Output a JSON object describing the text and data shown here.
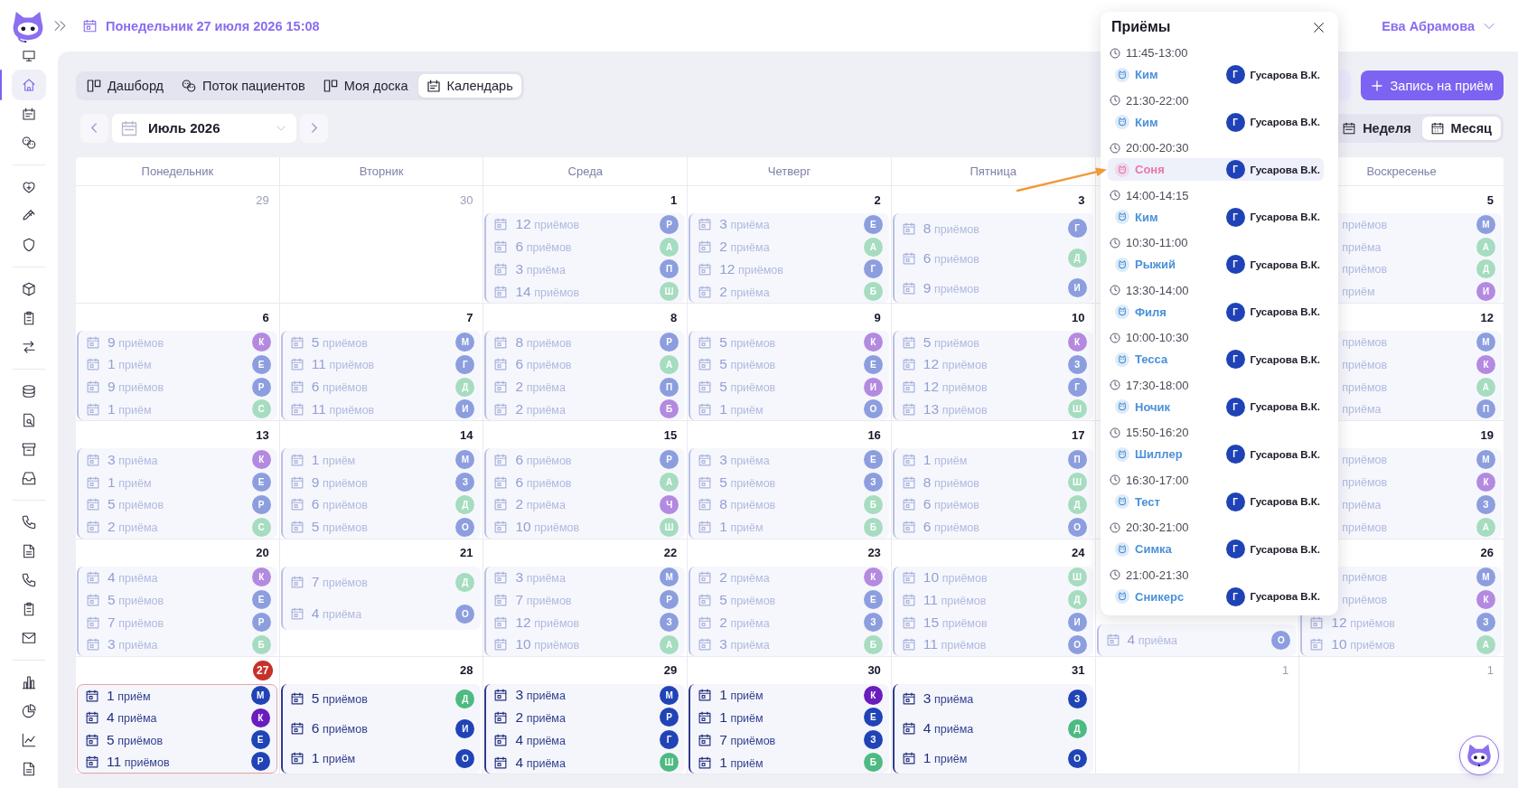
{
  "header": {
    "date": "Понедельник 27 июля 2026 15:08",
    "user": "Ева Абрамова"
  },
  "sidebar": {
    "groups": [
      [
        {
          "selected": false
        },
        {
          "selected": true
        },
        {
          "selected": false
        },
        {
          "selected": false
        }
      ],
      [
        {
          "selected": false
        },
        {
          "selected": false
        },
        {
          "selected": false
        }
      ],
      [
        {
          "selected": false
        },
        {
          "selected": false
        },
        {
          "selected": false
        }
      ],
      [
        {
          "selected": false
        },
        {
          "selected": false
        },
        {
          "selected": false
        },
        {
          "selected": false
        }
      ],
      [
        {
          "selected": false
        },
        {
          "selected": false
        },
        {
          "selected": false
        },
        {
          "selected": false
        },
        {
          "selected": false
        }
      ],
      [
        {
          "selected": false
        },
        {
          "selected": false
        },
        {
          "selected": false
        },
        {
          "selected": false
        }
      ]
    ]
  },
  "tabs": [
    {
      "label": "Дашборд",
      "selected": false
    },
    {
      "label": "Поток пациентов",
      "selected": false
    },
    {
      "label": "Моя доска",
      "selected": false
    },
    {
      "label": "Календарь",
      "selected": true
    }
  ],
  "new_appointment_button": "Запись на приём",
  "month_picker": {
    "value": "Июль 2026"
  },
  "view_switch": [
    {
      "label": "Неделя",
      "selected": false
    },
    {
      "label": "Месяц",
      "selected": true
    }
  ],
  "calendar": {
    "weekdays": {
      "mon": "Понедельник",
      "tue": "Вторник",
      "wed": "Среда",
      "thu": "Четверг",
      "fri": "Пятница",
      "sun": "Воскресенье"
    },
    "weeks": [
      {
        "mon": {
          "date": "29",
          "outside": true,
          "today": false
        },
        "tue": {
          "date": "30",
          "outside": true,
          "today": false
        },
        "wed": {
          "date": "1",
          "outside": false,
          "today": false,
          "past": true,
          "entries": [
            {
              "count": "12",
              "unit": "приёмов",
              "avatar": "Р",
              "color": "#8c9ede"
            },
            {
              "count": "6",
              "unit": "приёмов",
              "avatar": "А",
              "color": "#a6dcbf"
            },
            {
              "count": "3",
              "unit": "приёма",
              "avatar": "П",
              "color": "#8c9ede"
            },
            {
              "count": "14",
              "unit": "приёмов",
              "avatar": "Ш",
              "color": "#a6dcbf"
            }
          ]
        },
        "thu": {
          "date": "2",
          "outside": false,
          "today": false,
          "past": true,
          "entries": [
            {
              "count": "3",
              "unit": "приёма",
              "avatar": "Е",
              "color": "#8c9ede"
            },
            {
              "count": "2",
              "unit": "приёма",
              "avatar": "А",
              "color": "#a6dcbf"
            },
            {
              "count": "12",
              "unit": "приёмов",
              "avatar": "Г",
              "color": "#8c9ede"
            },
            {
              "count": "2",
              "unit": "приёма",
              "avatar": "Б",
              "color": "#a6dcbf"
            }
          ]
        },
        "fri": {
          "date": "3",
          "outside": false,
          "today": false,
          "past": true,
          "entries": [
            {
              "count": "8",
              "unit": "приёмов",
              "avatar": "Г",
              "color": "#8c9ede"
            },
            {
              "count": "6",
              "unit": "приёмов",
              "avatar": "Д",
              "color": "#a6dcbf"
            },
            {
              "count": "9",
              "unit": "приёмов",
              "avatar": "И",
              "color": "#8c9ede"
            }
          ]
        },
        "sun": {
          "date": "5",
          "outside": false,
          "today": false,
          "past": true,
          "entries": [
            {
              "unit": "приёмов",
              "avatar": "М",
              "color": "#8c9ede"
            },
            {
              "unit": "приёма",
              "avatar": "А",
              "color": "#a6dcbf"
            },
            {
              "unit": "приёмов",
              "avatar": "Д",
              "color": "#a6dcbf"
            },
            {
              "unit": "приём",
              "avatar": "И",
              "color": "#b38ae0"
            }
          ]
        }
      },
      {
        "mon": {
          "date": "6",
          "outside": false,
          "today": false,
          "past": true,
          "entries": [
            {
              "count": "9",
              "unit": "приёмов",
              "avatar": "К",
              "color": "#b38ae0"
            },
            {
              "count": "1",
              "unit": "приём",
              "avatar": "Е",
              "color": "#8c9ede"
            },
            {
              "count": "9",
              "unit": "приёмов",
              "avatar": "Р",
              "color": "#8c9ede"
            },
            {
              "count": "1",
              "unit": "приём",
              "avatar": "С",
              "color": "#a6dcbf"
            }
          ]
        },
        "tue": {
          "date": "7",
          "outside": false,
          "today": false,
          "past": true,
          "entries": [
            {
              "count": "5",
              "unit": "приёмов",
              "avatar": "М",
              "color": "#8c9ede"
            },
            {
              "count": "11",
              "unit": "приёмов",
              "avatar": "Г",
              "color": "#8c9ede"
            },
            {
              "count": "6",
              "unit": "приёмов",
              "avatar": "Д",
              "color": "#a6dcbf"
            },
            {
              "count": "11",
              "unit": "приёмов",
              "avatar": "И",
              "color": "#8c9ede"
            }
          ]
        },
        "wed": {
          "date": "8",
          "outside": false,
          "today": false,
          "past": true,
          "entries": [
            {
              "count": "8",
              "unit": "приёмов",
              "avatar": "Р",
              "color": "#8c9ede"
            },
            {
              "count": "6",
              "unit": "приёмов",
              "avatar": "А",
              "color": "#a6dcbf"
            },
            {
              "count": "2",
              "unit": "приёма",
              "avatar": "П",
              "color": "#8c9ede"
            },
            {
              "count": "2",
              "unit": "приёма",
              "avatar": "Б",
              "color": "#b38ae0"
            }
          ]
        },
        "thu": {
          "date": "9",
          "outside": false,
          "today": false,
          "past": true,
          "entries": [
            {
              "count": "5",
              "unit": "приёмов",
              "avatar": "К",
              "color": "#b38ae0"
            },
            {
              "count": "5",
              "unit": "приёмов",
              "avatar": "Е",
              "color": "#8c9ede"
            },
            {
              "count": "5",
              "unit": "приёмов",
              "avatar": "И",
              "color": "#b38ae0"
            },
            {
              "count": "1",
              "unit": "приём",
              "avatar": "О",
              "color": "#8c9ede"
            }
          ]
        },
        "fri": {
          "date": "10",
          "outside": false,
          "today": false,
          "past": true,
          "entries": [
            {
              "count": "5",
              "unit": "приёмов",
              "avatar": "К",
              "color": "#b38ae0"
            },
            {
              "count": "12",
              "unit": "приёмов",
              "avatar": "З",
              "color": "#8c9ede"
            },
            {
              "count": "12",
              "unit": "приёмов",
              "avatar": "Г",
              "color": "#8c9ede"
            },
            {
              "count": "13",
              "unit": "приёмов",
              "avatar": "Ш",
              "color": "#a6dcbf"
            }
          ]
        },
        "sun": {
          "date": "12",
          "outside": false,
          "today": false,
          "past": true,
          "entries": [
            {
              "unit": "приёмов",
              "avatar": "М",
              "color": "#8c9ede"
            },
            {
              "unit": "приёмов",
              "avatar": "К",
              "color": "#b38ae0"
            },
            {
              "unit": "приёмов",
              "avatar": "А",
              "color": "#a6dcbf"
            },
            {
              "unit": "приёма",
              "avatar": "П",
              "color": "#8c9ede"
            }
          ]
        }
      },
      {
        "mon": {
          "date": "13",
          "outside": false,
          "today": false,
          "past": true,
          "entries": [
            {
              "count": "3",
              "unit": "приёма",
              "avatar": "К",
              "color": "#b38ae0"
            },
            {
              "count": "1",
              "unit": "приём",
              "avatar": "Е",
              "color": "#8c9ede"
            },
            {
              "count": "5",
              "unit": "приёмов",
              "avatar": "Р",
              "color": "#8c9ede"
            },
            {
              "count": "2",
              "unit": "приёма",
              "avatar": "С",
              "color": "#a6dcbf"
            }
          ]
        },
        "tue": {
          "date": "14",
          "outside": false,
          "today": false,
          "past": true,
          "entries": [
            {
              "count": "1",
              "unit": "приём",
              "avatar": "М",
              "color": "#8c9ede"
            },
            {
              "count": "9",
              "unit": "приёмов",
              "avatar": "З",
              "color": "#8c9ede"
            },
            {
              "count": "6",
              "unit": "приёмов",
              "avatar": "Д",
              "color": "#a6dcbf"
            },
            {
              "count": "5",
              "unit": "приёмов",
              "avatar": "О",
              "color": "#8c9ede"
            }
          ]
        },
        "wed": {
          "date": "15",
          "outside": false,
          "today": false,
          "past": true,
          "entries": [
            {
              "count": "6",
              "unit": "приёмов",
              "avatar": "Р",
              "color": "#8c9ede"
            },
            {
              "count": "6",
              "unit": "приёмов",
              "avatar": "А",
              "color": "#a6dcbf"
            },
            {
              "count": "2",
              "unit": "приёма",
              "avatar": "Ч",
              "color": "#b38ae0"
            },
            {
              "count": "10",
              "unit": "приёмов",
              "avatar": "Ш",
              "color": "#a6dcbf"
            }
          ]
        },
        "thu": {
          "date": "16",
          "outside": false,
          "today": false,
          "past": true,
          "entries": [
            {
              "count": "3",
              "unit": "приёма",
              "avatar": "Е",
              "color": "#8c9ede"
            },
            {
              "count": "5",
              "unit": "приёмов",
              "avatar": "З",
              "color": "#8c9ede"
            },
            {
              "count": "8",
              "unit": "приёмов",
              "avatar": "Б",
              "color": "#a6dcbf"
            },
            {
              "count": "1",
              "unit": "приём",
              "avatar": "Б",
              "color": "#a6dcbf"
            }
          ]
        },
        "fri": {
          "date": "17",
          "outside": false,
          "today": false,
          "past": true,
          "entries": [
            {
              "count": "1",
              "unit": "приём",
              "avatar": "П",
              "color": "#8c9ede"
            },
            {
              "count": "8",
              "unit": "приёмов",
              "avatar": "Ш",
              "color": "#a6dcbf"
            },
            {
              "count": "6",
              "unit": "приёмов",
              "avatar": "Д",
              "color": "#a6dcbf"
            },
            {
              "count": "6",
              "unit": "приёмов",
              "avatar": "О",
              "color": "#8c9ede"
            }
          ]
        },
        "sun": {
          "date": "19",
          "outside": false,
          "today": false,
          "past": true,
          "entries": [
            {
              "unit": "приёмов",
              "avatar": "М",
              "color": "#8c9ede"
            },
            {
              "unit": "приёмов",
              "avatar": "К",
              "color": "#b38ae0"
            },
            {
              "unit": "приёма",
              "avatar": "З",
              "color": "#8c9ede"
            },
            {
              "unit": "приёмов",
              "avatar": "А",
              "color": "#a6dcbf"
            }
          ]
        }
      },
      {
        "mon": {
          "date": "20",
          "outside": false,
          "today": false,
          "past": true,
          "entries": [
            {
              "count": "4",
              "unit": "приёма",
              "avatar": "К",
              "color": "#b38ae0"
            },
            {
              "count": "5",
              "unit": "приёмов",
              "avatar": "Е",
              "color": "#8c9ede"
            },
            {
              "count": "7",
              "unit": "приёмов",
              "avatar": "Р",
              "color": "#8c9ede"
            },
            {
              "count": "3",
              "unit": "приёма",
              "avatar": "Б",
              "color": "#a6dcbf"
            }
          ]
        },
        "tue": {
          "date": "21",
          "outside": false,
          "today": false,
          "past": true,
          "entries": [
            {
              "count": "7",
              "unit": "приёмов",
              "avatar": "Д",
              "color": "#a6dcbf"
            },
            {
              "count": "4",
              "unit": "приёма",
              "avatar": "О",
              "color": "#8c9ede"
            }
          ]
        },
        "wed": {
          "date": "22",
          "outside": false,
          "today": false,
          "past": true,
          "entries": [
            {
              "count": "3",
              "unit": "приёма",
              "avatar": "М",
              "color": "#8c9ede"
            },
            {
              "count": "7",
              "unit": "приёмов",
              "avatar": "Р",
              "color": "#8c9ede"
            },
            {
              "count": "12",
              "unit": "приёмов",
              "avatar": "З",
              "color": "#8c9ede"
            },
            {
              "count": "10",
              "unit": "приёмов",
              "avatar": "А",
              "color": "#a6dcbf"
            }
          ]
        },
        "thu": {
          "date": "23",
          "outside": false,
          "today": false,
          "past": true,
          "entries": [
            {
              "count": "2",
              "unit": "приёма",
              "avatar": "К",
              "color": "#b38ae0"
            },
            {
              "count": "5",
              "unit": "приёмов",
              "avatar": "Е",
              "color": "#8c9ede"
            },
            {
              "count": "2",
              "unit": "приёма",
              "avatar": "З",
              "color": "#8c9ede"
            },
            {
              "count": "3",
              "unit": "приёма",
              "avatar": "Б",
              "color": "#a6dcbf"
            }
          ]
        },
        "fri": {
          "date": "24",
          "outside": false,
          "today": false,
          "past": true,
          "entries": [
            {
              "count": "10",
              "unit": "приёмов",
              "avatar": "Ш",
              "color": "#a6dcbf"
            },
            {
              "count": "11",
              "unit": "приёмов",
              "avatar": "Д",
              "color": "#a6dcbf"
            },
            {
              "count": "15",
              "unit": "приёмов",
              "avatar": "И",
              "color": "#8c9ede"
            },
            {
              "count": "11",
              "unit": "приёмов",
              "avatar": "О",
              "color": "#8c9ede"
            }
          ]
        },
        "sat": {
          "today": false,
          "past": true,
          "entries": [
            {
              "count": "4",
              "unit": "приёма",
              "avatar": "О",
              "color": "#8c9ede"
            }
          ]
        },
        "sun": {
          "date": "26",
          "outside": false,
          "today": false,
          "past": true,
          "entries": [
            {
              "unit": "приёмов",
              "avatar": "М",
              "color": "#8c9ede"
            },
            {
              "unit": "приёмов",
              "avatar": "К",
              "color": "#b38ae0"
            },
            {
              "count": "12",
              "unit": "приёмов",
              "avatar": "З",
              "color": "#8c9ede"
            },
            {
              "count": "10",
              "unit": "приёмов",
              "avatar": "А",
              "color": "#a6dcbf"
            }
          ]
        }
      },
      {
        "mon": {
          "date": "27",
          "outside": false,
          "today": true,
          "past": false,
          "entries": [
            {
              "count": "1",
              "unit": "приём",
              "avatar": "М",
              "color": "#2044b6"
            },
            {
              "count": "4",
              "unit": "приёма",
              "avatar": "К",
              "color": "#6a1cbd"
            },
            {
              "count": "5",
              "unit": "приёмов",
              "avatar": "Е",
              "color": "#2044b6"
            },
            {
              "count": "11",
              "unit": "приёмов",
              "avatar": "Р",
              "color": "#2044b6"
            }
          ]
        },
        "tue": {
          "date": "28",
          "outside": false,
          "today": false,
          "past": false,
          "entries": [
            {
              "count": "5",
              "unit": "приёмов",
              "avatar": "Д",
              "color": "#4dbb81"
            },
            {
              "count": "6",
              "unit": "приёмов",
              "avatar": "И",
              "color": "#2044b6"
            },
            {
              "count": "1",
              "unit": "приём",
              "avatar": "О",
              "color": "#2044b6"
            }
          ]
        },
        "wed": {
          "date": "29",
          "outside": false,
          "today": false,
          "past": false,
          "entries": [
            {
              "count": "3",
              "unit": "приёма",
              "avatar": "М",
              "color": "#2044b6"
            },
            {
              "count": "2",
              "unit": "приёма",
              "avatar": "Р",
              "color": "#2044b6"
            },
            {
              "count": "4",
              "unit": "приёма",
              "avatar": "Г",
              "color": "#2044b6"
            },
            {
              "count": "4",
              "unit": "приёма",
              "avatar": "Ш",
              "color": "#4dbb81"
            }
          ]
        },
        "thu": {
          "date": "30",
          "outside": false,
          "today": false,
          "past": false,
          "entries": [
            {
              "count": "1",
              "unit": "приём",
              "avatar": "К",
              "color": "#6a1cbd"
            },
            {
              "count": "1",
              "unit": "приём",
              "avatar": "Е",
              "color": "#2044b6"
            },
            {
              "count": "7",
              "unit": "приёмов",
              "avatar": "З",
              "color": "#2044b6"
            },
            {
              "count": "1",
              "unit": "приём",
              "avatar": "Б",
              "color": "#4dbb81"
            }
          ]
        },
        "fri": {
          "date": "31",
          "outside": false,
          "today": false,
          "past": false,
          "entries": [
            {
              "count": "3",
              "unit": "приёма",
              "avatar": "З",
              "color": "#2044b6"
            },
            {
              "count": "4",
              "unit": "приёма",
              "avatar": "Д",
              "color": "#4dbb81"
            },
            {
              "count": "1",
              "unit": "приём",
              "avatar": "О",
              "color": "#2044b6"
            }
          ]
        },
        "sat": {
          "date": "1",
          "outside": true,
          "today": false
        },
        "sun": {
          "date": "1",
          "outside": true,
          "today": false
        }
      }
    ]
  },
  "popup": {
    "title": "Приёмы",
    "appointments": [
      {
        "time": "11:45-13:00",
        "pet": "Ким",
        "color": "#4a90d9",
        "doctor_initial": "Г",
        "doctor": "Гусарова В.К.",
        "selected": false
      },
      {
        "time": "21:30-22:00",
        "pet": "Ким",
        "color": "#4a90d9",
        "doctor_initial": "Г",
        "doctor": "Гусарова В.К.",
        "selected": false
      },
      {
        "time": "20:00-20:30",
        "pet": "Соня",
        "color": "#e879a9",
        "doctor_initial": "Г",
        "doctor": "Гусарова В.К.",
        "selected": true
      },
      {
        "time": "14:00-14:15",
        "pet": "Ким",
        "color": "#4a90d9",
        "doctor_initial": "Г",
        "doctor": "Гусарова В.К.",
        "selected": false
      },
      {
        "time": "10:30-11:00",
        "pet": "Рыжий",
        "color": "#4a90d9",
        "doctor_initial": "Г",
        "doctor": "Гусарова В.К.",
        "selected": false
      },
      {
        "time": "13:30-14:00",
        "pet": "Филя",
        "color": "#4a90d9",
        "doctor_initial": "Г",
        "doctor": "Гусарова В.К.",
        "selected": false
      },
      {
        "time": "10:00-10:30",
        "pet": "Тесса",
        "color": "#4a90d9",
        "doctor_initial": "Г",
        "doctor": "Гусарова В.К.",
        "selected": false
      },
      {
        "time": "17:30-18:00",
        "pet": "Ночик",
        "color": "#4a90d9",
        "doctor_initial": "Г",
        "doctor": "Гусарова В.К.",
        "selected": false
      },
      {
        "time": "15:50-16:20",
        "pet": "Шиллер",
        "color": "#4a90d9",
        "doctor_initial": "Г",
        "doctor": "Гусарова В.К.",
        "selected": false
      },
      {
        "time": "16:30-17:00",
        "pet": "Тест",
        "color": "#4a90d9",
        "doctor_initial": "Г",
        "doctor": "Гусарова В.К.",
        "selected": false
      },
      {
        "time": "20:30-21:00",
        "pet": "Симка",
        "color": "#4a90d9",
        "doctor_initial": "Г",
        "doctor": "Гусарова В.К.",
        "selected": false
      },
      {
        "time": "21:00-21:30",
        "pet": "Сникерс",
        "color": "#4a90d9",
        "doctor_initial": "Г",
        "doctor": "Гусарова В.К.",
        "selected": false
      }
    ]
  }
}
